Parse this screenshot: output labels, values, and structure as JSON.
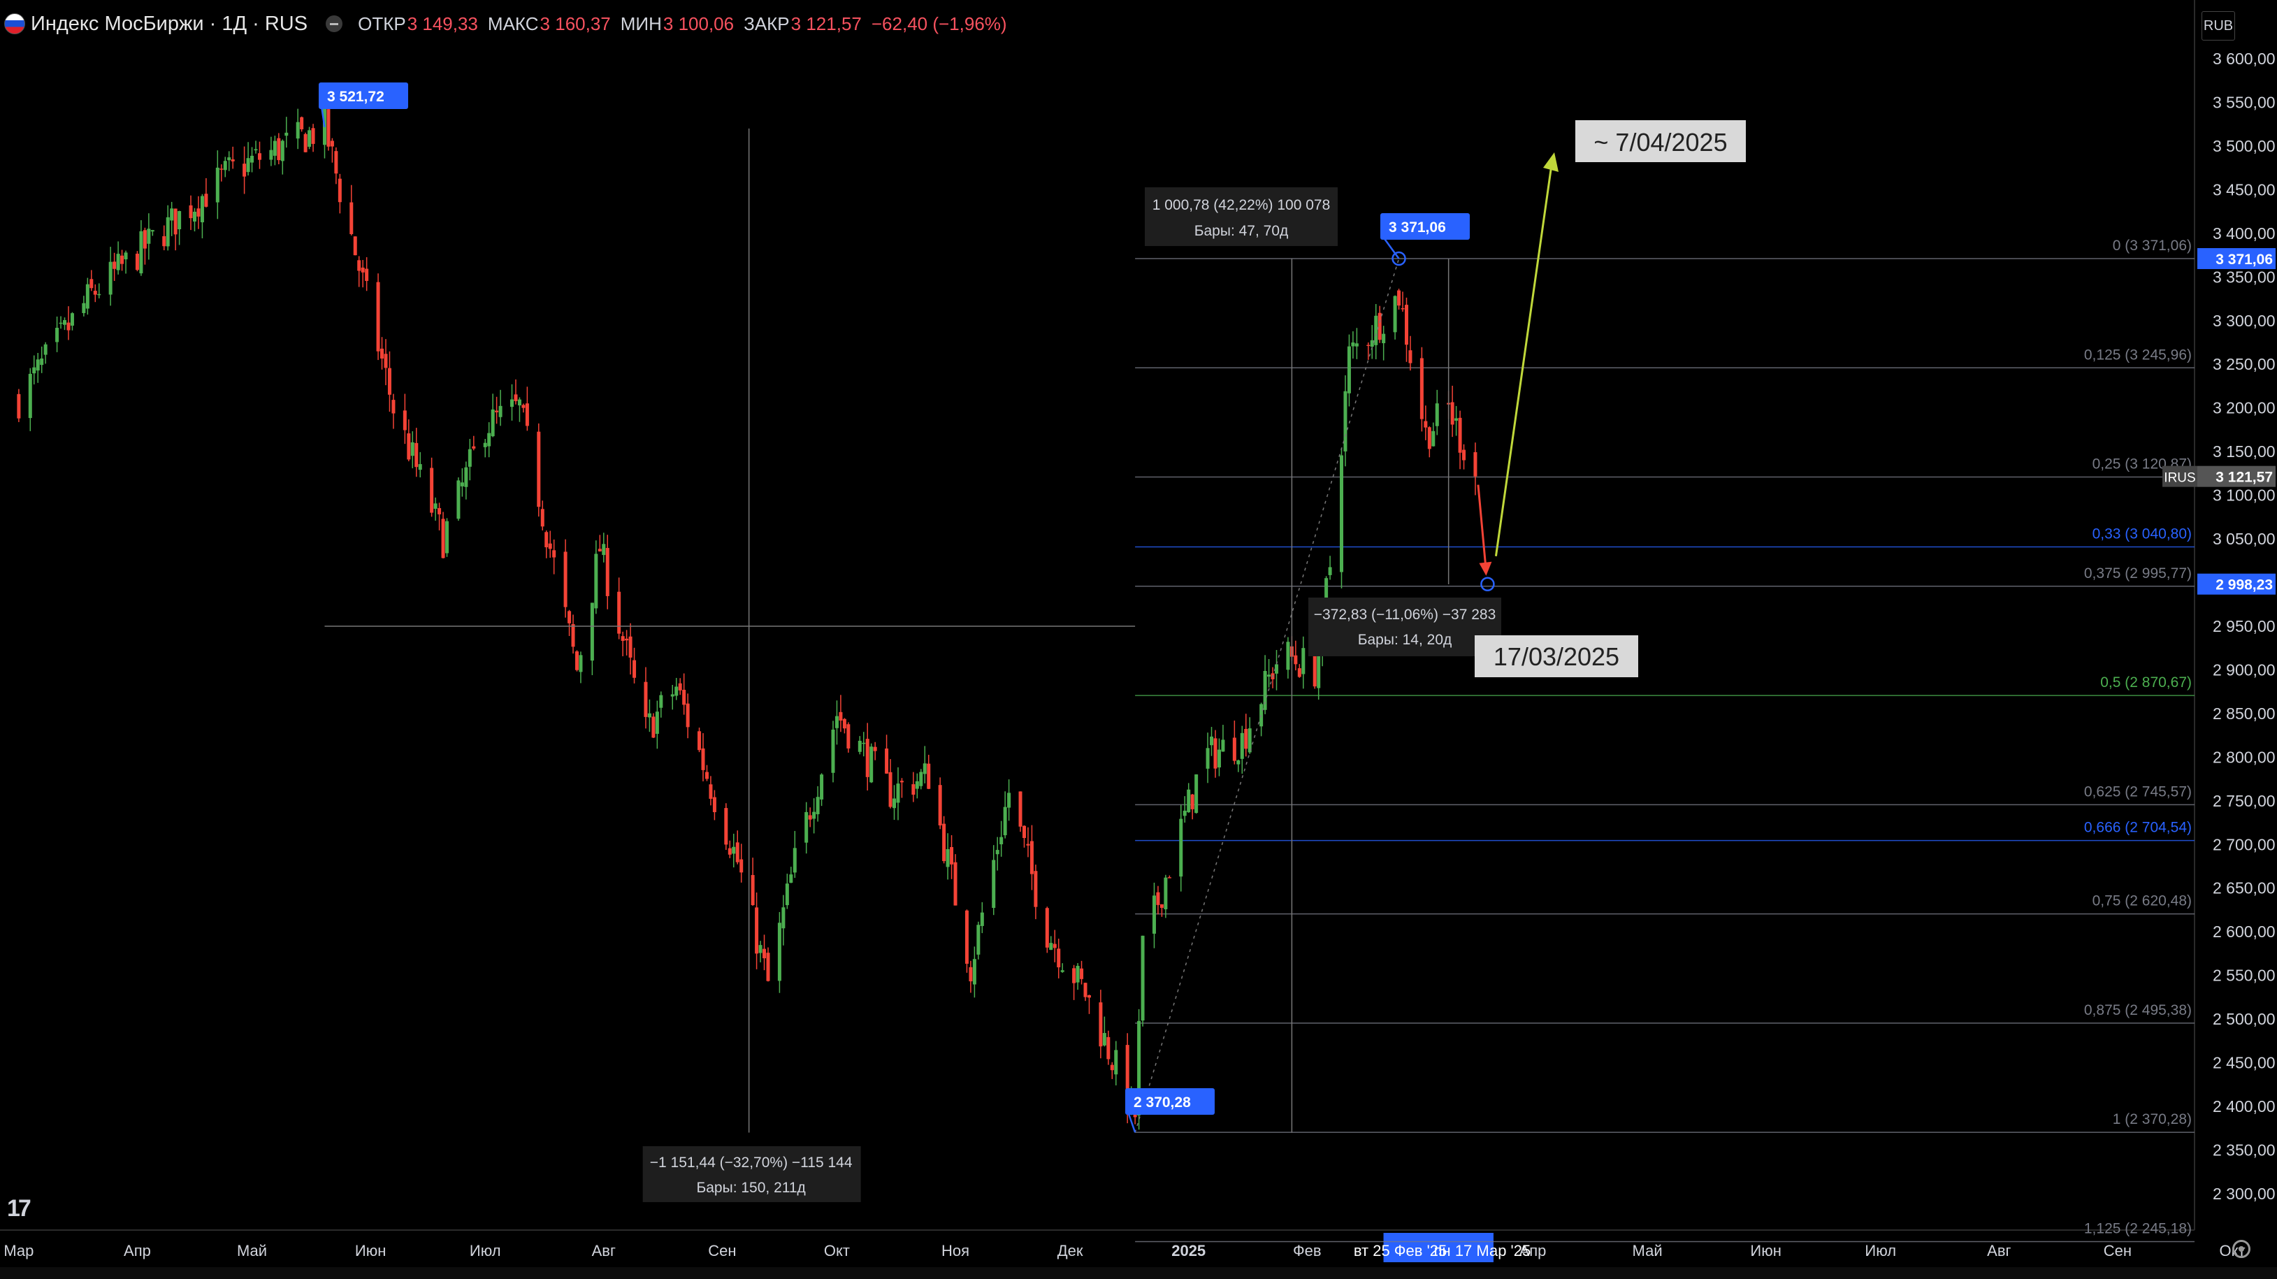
{
  "header": {
    "title": "Индекс МосБиржи · 1Д · RUS",
    "open_label": "ОТКР",
    "open": "3 149,33",
    "high_label": "МАКС",
    "high": "3 160,37",
    "low_label": "МИН",
    "low": "3 100,06",
    "close_label": "ЗАКР",
    "close": "3 121,57",
    "change": "−62,40 (−1,96%)"
  },
  "currency": "RUB",
  "colors": {
    "up": "#4caf50",
    "down": "#f44336",
    "blue_label": "#2962ff",
    "target_arrow": "#c0d83a",
    "fib_line": "#787b86"
  },
  "chart_data": {
    "type": "candlestick",
    "title": "Индекс МосБиржи · 1Д · RUS",
    "ylim": [
      2245,
      3640
    ],
    "y_ticks": [
      "3 600,00",
      "3 550,00",
      "3 500,00",
      "3 450,00",
      "3 400,00",
      "3 350,00",
      "3 300,00",
      "3 250,00",
      "3 200,00",
      "3 150,00",
      "3 100,00",
      "3 050,00",
      "3 000,00",
      "2 950,00",
      "2 900,00",
      "2 850,00",
      "2 800,00",
      "2 750,00",
      "2 700,00",
      "2 650,00",
      "2 600,00",
      "2 550,00",
      "2 500,00",
      "2 450,00",
      "2 400,00",
      "2 350,00",
      "2 300,00"
    ],
    "x_ticks": [
      "Мар",
      "Апр",
      "Май",
      "Июн",
      "Июл",
      "Авг",
      "Сен",
      "Окт",
      "Ноя",
      "Дек",
      "2025",
      "Фев",
      "Мар",
      "Апр",
      "Май",
      "Июн",
      "Июл",
      "Авг",
      "Сен",
      "Окт"
    ],
    "anchors": [
      {
        "date": "2024-03-01",
        "value": 3210
      },
      {
        "date": "2024-03-20",
        "value": 3330
      },
      {
        "date": "2024-04-25",
        "value": 3470
      },
      {
        "date": "2024-05-20",
        "value": 3521.72
      },
      {
        "date": "2024-06-07",
        "value": 3200
      },
      {
        "date": "2024-06-20",
        "value": 3050
      },
      {
        "date": "2024-07-01",
        "value": 3180
      },
      {
        "date": "2024-07-10",
        "value": 3200
      },
      {
        "date": "2024-07-25",
        "value": 2900
      },
      {
        "date": "2024-07-31",
        "value": 3040
      },
      {
        "date": "2024-08-12",
        "value": 2830
      },
      {
        "date": "2024-08-20",
        "value": 2880
      },
      {
        "date": "2024-09-05",
        "value": 2680
      },
      {
        "date": "2024-09-13",
        "value": 2540
      },
      {
        "date": "2024-09-20",
        "value": 2680
      },
      {
        "date": "2024-10-01",
        "value": 2850
      },
      {
        "date": "2024-10-15",
        "value": 2760
      },
      {
        "date": "2024-10-25",
        "value": 2780
      },
      {
        "date": "2024-11-05",
        "value": 2560
      },
      {
        "date": "2024-11-15",
        "value": 2760
      },
      {
        "date": "2024-11-25",
        "value": 2600
      },
      {
        "date": "2024-12-05",
        "value": 2530
      },
      {
        "date": "2024-12-18",
        "value": 2390
      },
      {
        "date": "2024-12-20",
        "value": 2580
      },
      {
        "date": "2025-01-05",
        "value": 2800
      },
      {
        "date": "2025-01-15",
        "value": 2820
      },
      {
        "date": "2025-01-25",
        "value": 2920
      },
      {
        "date": "2025-02-03",
        "value": 2900
      },
      {
        "date": "2025-02-07",
        "value": 3020
      },
      {
        "date": "2025-02-12",
        "value": 3260
      },
      {
        "date": "2025-02-20",
        "value": 3300
      },
      {
        "date": "2025-02-25",
        "value": 3330
      },
      {
        "date": "2025-03-04",
        "value": 3170
      },
      {
        "date": "2025-03-10",
        "value": 3200
      },
      {
        "date": "2025-03-17",
        "value": 3121.57
      }
    ],
    "annotations": {
      "high_label": "3 521,72",
      "low_label": "2 370,28",
      "peak_label": "3 371,06",
      "projection_low_value": "2 998,23",
      "projection_high_label": "~ 7/04/2025",
      "projection_date_label": "17/03/2025",
      "measure_big": {
        "text": "−1 151,44 (−32,70%) −115 144",
        "bars": "Бары: 150, 211д"
      },
      "measure_up": {
        "text": "1 000,78 (42,22%) 100 078",
        "bars": "Бары: 47, 70д"
      },
      "measure_down": {
        "text": "−372,83 (−11,06%) −37 283",
        "bars": "Бары: 14, 20д"
      }
    },
    "fib_levels": [
      {
        "label": "0 (3 371,06)",
        "value": 3371.06,
        "color": "#787b86"
      },
      {
        "label": "0,125 (3 245,96)",
        "value": 3245.96,
        "color": "#787b86"
      },
      {
        "label": "0,25 (3 120,87)",
        "value": 3120.87,
        "color": "#787b86"
      },
      {
        "label": "0,33 (3 040,80)",
        "value": 3040.8,
        "color": "#2962ff"
      },
      {
        "label": "0,375 (2 995,77)",
        "value": 2995.77,
        "color": "#787b86"
      },
      {
        "label": "0,5 (2 870,67)",
        "value": 2870.67,
        "color": "#4caf50"
      },
      {
        "label": "0,625 (2 745,57)",
        "value": 2745.57,
        "color": "#787b86"
      },
      {
        "label": "0,666 (2 704,54)",
        "value": 2704.54,
        "color": "#2962ff"
      },
      {
        "label": "0,75 (2 620,48)",
        "value": 2620.48,
        "color": "#787b86"
      },
      {
        "label": "0,875 (2 495,38)",
        "value": 2495.38,
        "color": "#787b86"
      },
      {
        "label": "1 (2 370,28)",
        "value": 2370.28,
        "color": "#787b86"
      },
      {
        "label": "1,125 (2 245,18)",
        "value": 2245.18,
        "color": "#787b86"
      }
    ],
    "price_tags": [
      {
        "label": "3 371,06",
        "value": 3371.06,
        "color": "#2962ff"
      },
      {
        "label": "3 121,57",
        "value": 3121.57,
        "color": "#555555",
        "prefix": "IRUS"
      },
      {
        "label": "2 998,23",
        "value": 2998.23,
        "color": "#2962ff"
      }
    ],
    "x_range_highlight": [
      "вт 25 Фев '25",
      "пн 17 Мар '25"
    ]
  }
}
